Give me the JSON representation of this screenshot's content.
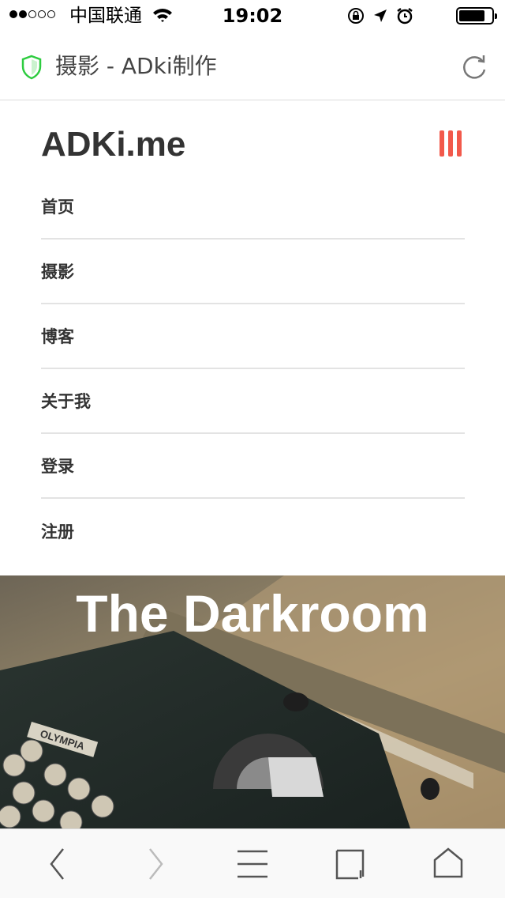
{
  "status_bar": {
    "carrier": "中国联通",
    "time": "19:02",
    "signal_bars_filled": 2,
    "signal_bars_total": 5
  },
  "browser": {
    "page_title": "摄影 - ADki制作",
    "icons": [
      "shield-icon",
      "reload-icon"
    ]
  },
  "site": {
    "logo": "ADKi.me",
    "menu_icon": "menu-bars-icon",
    "accent_color": "#f2594b"
  },
  "nav": {
    "items": [
      {
        "label": "首页"
      },
      {
        "label": "摄影"
      },
      {
        "label": "博客"
      },
      {
        "label": "关于我"
      },
      {
        "label": "登录"
      },
      {
        "label": "注册"
      }
    ]
  },
  "hero": {
    "title": "The Darkroom",
    "typewriter_label": "OLYMPIA"
  },
  "toolbar": {
    "icons": [
      "back-icon",
      "forward-icon",
      "menu-icon",
      "tabs-icon",
      "home-icon"
    ]
  }
}
